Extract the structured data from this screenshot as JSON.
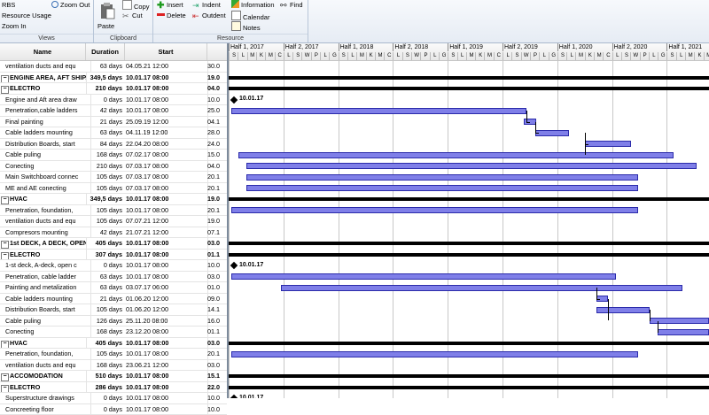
{
  "ribbon": {
    "views": {
      "label": "Views",
      "items": [
        "RBS",
        "Resource Usage",
        "Zoom In",
        "Zoom Out"
      ]
    },
    "clipboard": {
      "label": "Clipboard",
      "paste": "Paste",
      "copy": "Copy",
      "cut": "Cut"
    },
    "resource": {
      "label": "Resource",
      "insert": "Insert",
      "delete": "Delete",
      "indent": "Indent",
      "outdent": "Outdent",
      "information": "Information",
      "calendar": "Calendar",
      "notes": "Notes",
      "find": "Find"
    }
  },
  "grid": {
    "columns": {
      "name": "Name",
      "duration": "Duration",
      "start": "Start"
    },
    "rows": [
      {
        "name": "ventilation ducts and equ",
        "duration": "63 days",
        "start": "04.05.21 12:00",
        "finish": "30.0",
        "level": 2,
        "summary": false
      },
      {
        "name": "ENGINE AREA, AFT SHIP, I",
        "duration": "349,5 days",
        "start": "10.01.17 08:00",
        "finish": "19.0",
        "level": 0,
        "summary": true
      },
      {
        "name": "ELECTRO",
        "duration": "210 days",
        "start": "10.01.17 08:00",
        "finish": "04.0",
        "level": 0,
        "summary": true
      },
      {
        "name": "Engine and Aft area draw",
        "duration": "0 days",
        "start": "10.01.17 08:00",
        "finish": "10.0",
        "level": 2,
        "summary": false
      },
      {
        "name": "Penetration,cable ladders",
        "duration": "42 days",
        "start": "10.01.17 08:00",
        "finish": "25.0",
        "level": 2,
        "summary": false
      },
      {
        "name": "Final painting",
        "duration": "21 days",
        "start": "25.09.19 12:00",
        "finish": "04.1",
        "level": 2,
        "summary": false
      },
      {
        "name": "Cable ladders mounting",
        "duration": "63 days",
        "start": "04.11.19 12:00",
        "finish": "28.0",
        "level": 2,
        "summary": false
      },
      {
        "name": "Distribution Boards, start",
        "duration": "84 days",
        "start": "22.04.20 08:00",
        "finish": "24.0",
        "level": 2,
        "summary": false
      },
      {
        "name": "Cable puling",
        "duration": "168 days",
        "start": "07.02.17 08:00",
        "finish": "15.0",
        "level": 2,
        "summary": false
      },
      {
        "name": "Conecting",
        "duration": "210 days",
        "start": "07.03.17 08:00",
        "finish": "04.0",
        "level": 2,
        "summary": false
      },
      {
        "name": "Main Switchboard connec",
        "duration": "105 days",
        "start": "07.03.17 08:00",
        "finish": "20.1",
        "level": 2,
        "summary": false
      },
      {
        "name": "ME and AE conecting",
        "duration": "105 days",
        "start": "07.03.17 08:00",
        "finish": "20.1",
        "level": 2,
        "summary": false
      },
      {
        "name": "HVAC",
        "duration": "349,5 days",
        "start": "10.01.17 08:00",
        "finish": "19.0",
        "level": 0,
        "summary": true
      },
      {
        "name": "Penetration, foundation,",
        "duration": "105 days",
        "start": "10.01.17 08:00",
        "finish": "20.1",
        "level": 2,
        "summary": false
      },
      {
        "name": "ventilation ducts and equ",
        "duration": "105 days",
        "start": "07.07.21 12:00",
        "finish": "19.0",
        "level": 2,
        "summary": false
      },
      {
        "name": "Compresors mounting",
        "duration": "42 days",
        "start": "21.07.21 12:00",
        "finish": "07.1",
        "level": 2,
        "summary": false
      },
      {
        "name": "1st DECK, A DECK, OPEN D",
        "duration": "405 days",
        "start": "10.01.17 08:00",
        "finish": "03.0",
        "level": 0,
        "summary": true
      },
      {
        "name": "ELECTRO",
        "duration": "307 days",
        "start": "10.01.17 08:00",
        "finish": "01.1",
        "level": 0,
        "summary": true
      },
      {
        "name": "1-st deck, A-deck, open c",
        "duration": "0 days",
        "start": "10.01.17 08:00",
        "finish": "10.0",
        "level": 2,
        "summary": false
      },
      {
        "name": "Penetration, cable ladder",
        "duration": "63 days",
        "start": "10.01.17 08:00",
        "finish": "03.0",
        "level": 2,
        "summary": false
      },
      {
        "name": "Painting and metalization",
        "duration": "63 days",
        "start": "03.07.17 06:00",
        "finish": "01.0",
        "level": 2,
        "summary": false
      },
      {
        "name": "Cable ladders mounting",
        "duration": "21 days",
        "start": "01.06.20 12:00",
        "finish": "09.0",
        "level": 2,
        "summary": false
      },
      {
        "name": "Distribution Boards, start",
        "duration": "105 days",
        "start": "01.06.20 12:00",
        "finish": "14.1",
        "level": 2,
        "summary": false
      },
      {
        "name": "Cable puling",
        "duration": "126 days",
        "start": "25.11.20 08:00",
        "finish": "16.0",
        "level": 2,
        "summary": false
      },
      {
        "name": "Conecting",
        "duration": "168 days",
        "start": "23.12.20 08:00",
        "finish": "01.1",
        "level": 2,
        "summary": false
      },
      {
        "name": "HVAC",
        "duration": "405 days",
        "start": "10.01.17 08:00",
        "finish": "03.0",
        "level": 0,
        "summary": true
      },
      {
        "name": "Penetration, foundation,",
        "duration": "105 days",
        "start": "10.01.17 08:00",
        "finish": "20.1",
        "level": 2,
        "summary": false
      },
      {
        "name": "ventilation ducts and equ",
        "duration": "168 days",
        "start": "23.06.21 12:00",
        "finish": "03.0",
        "level": 2,
        "summary": false
      },
      {
        "name": "ACCOMODATION",
        "duration": "510 days",
        "start": "10.01.17 08:00",
        "finish": "15.1",
        "level": 0,
        "summary": true
      },
      {
        "name": "ELECTRO",
        "duration": "286 days",
        "start": "10.01.17 08:00",
        "finish": "22.0",
        "level": 0,
        "summary": true
      },
      {
        "name": "Superstructure drawings",
        "duration": "0 days",
        "start": "10.01.17 08:00",
        "finish": "10.0",
        "level": 2,
        "summary": false
      },
      {
        "name": "Concreeting floor",
        "duration": "0 days",
        "start": "10.01.17 08:00",
        "finish": "10.0",
        "level": 2,
        "summary": false
      }
    ]
  },
  "timeline": {
    "halves": [
      "Half 1, 2017",
      "Half 2, 2017",
      "Half 1, 2018",
      "Half 2, 2018",
      "Half 1, 2019",
      "Half 2, 2019",
      "Half 1, 2020",
      "Half 2, 2020",
      "Half 1, 2021"
    ],
    "month_letters": [
      "S",
      "L",
      "M",
      "K",
      "M",
      "C",
      "L",
      "S",
      "W",
      "P",
      "L",
      "G",
      "S",
      "L",
      "M",
      "K",
      "M",
      "C",
      "L",
      "S",
      "W",
      "P",
      "L",
      "G",
      "S",
      "L",
      "M",
      "K",
      "M",
      "C",
      "L",
      "S",
      "W",
      "P",
      "L",
      "G",
      "S",
      "L",
      "M",
      "K",
      "M",
      "C",
      "L",
      "S",
      "W",
      "P",
      "L",
      "G",
      "S",
      "L",
      "M",
      "K",
      "M",
      "C"
    ],
    "milestone_label": "10.01.17",
    "bar_color": "#7f7fe8",
    "summary_color": "#000000"
  }
}
